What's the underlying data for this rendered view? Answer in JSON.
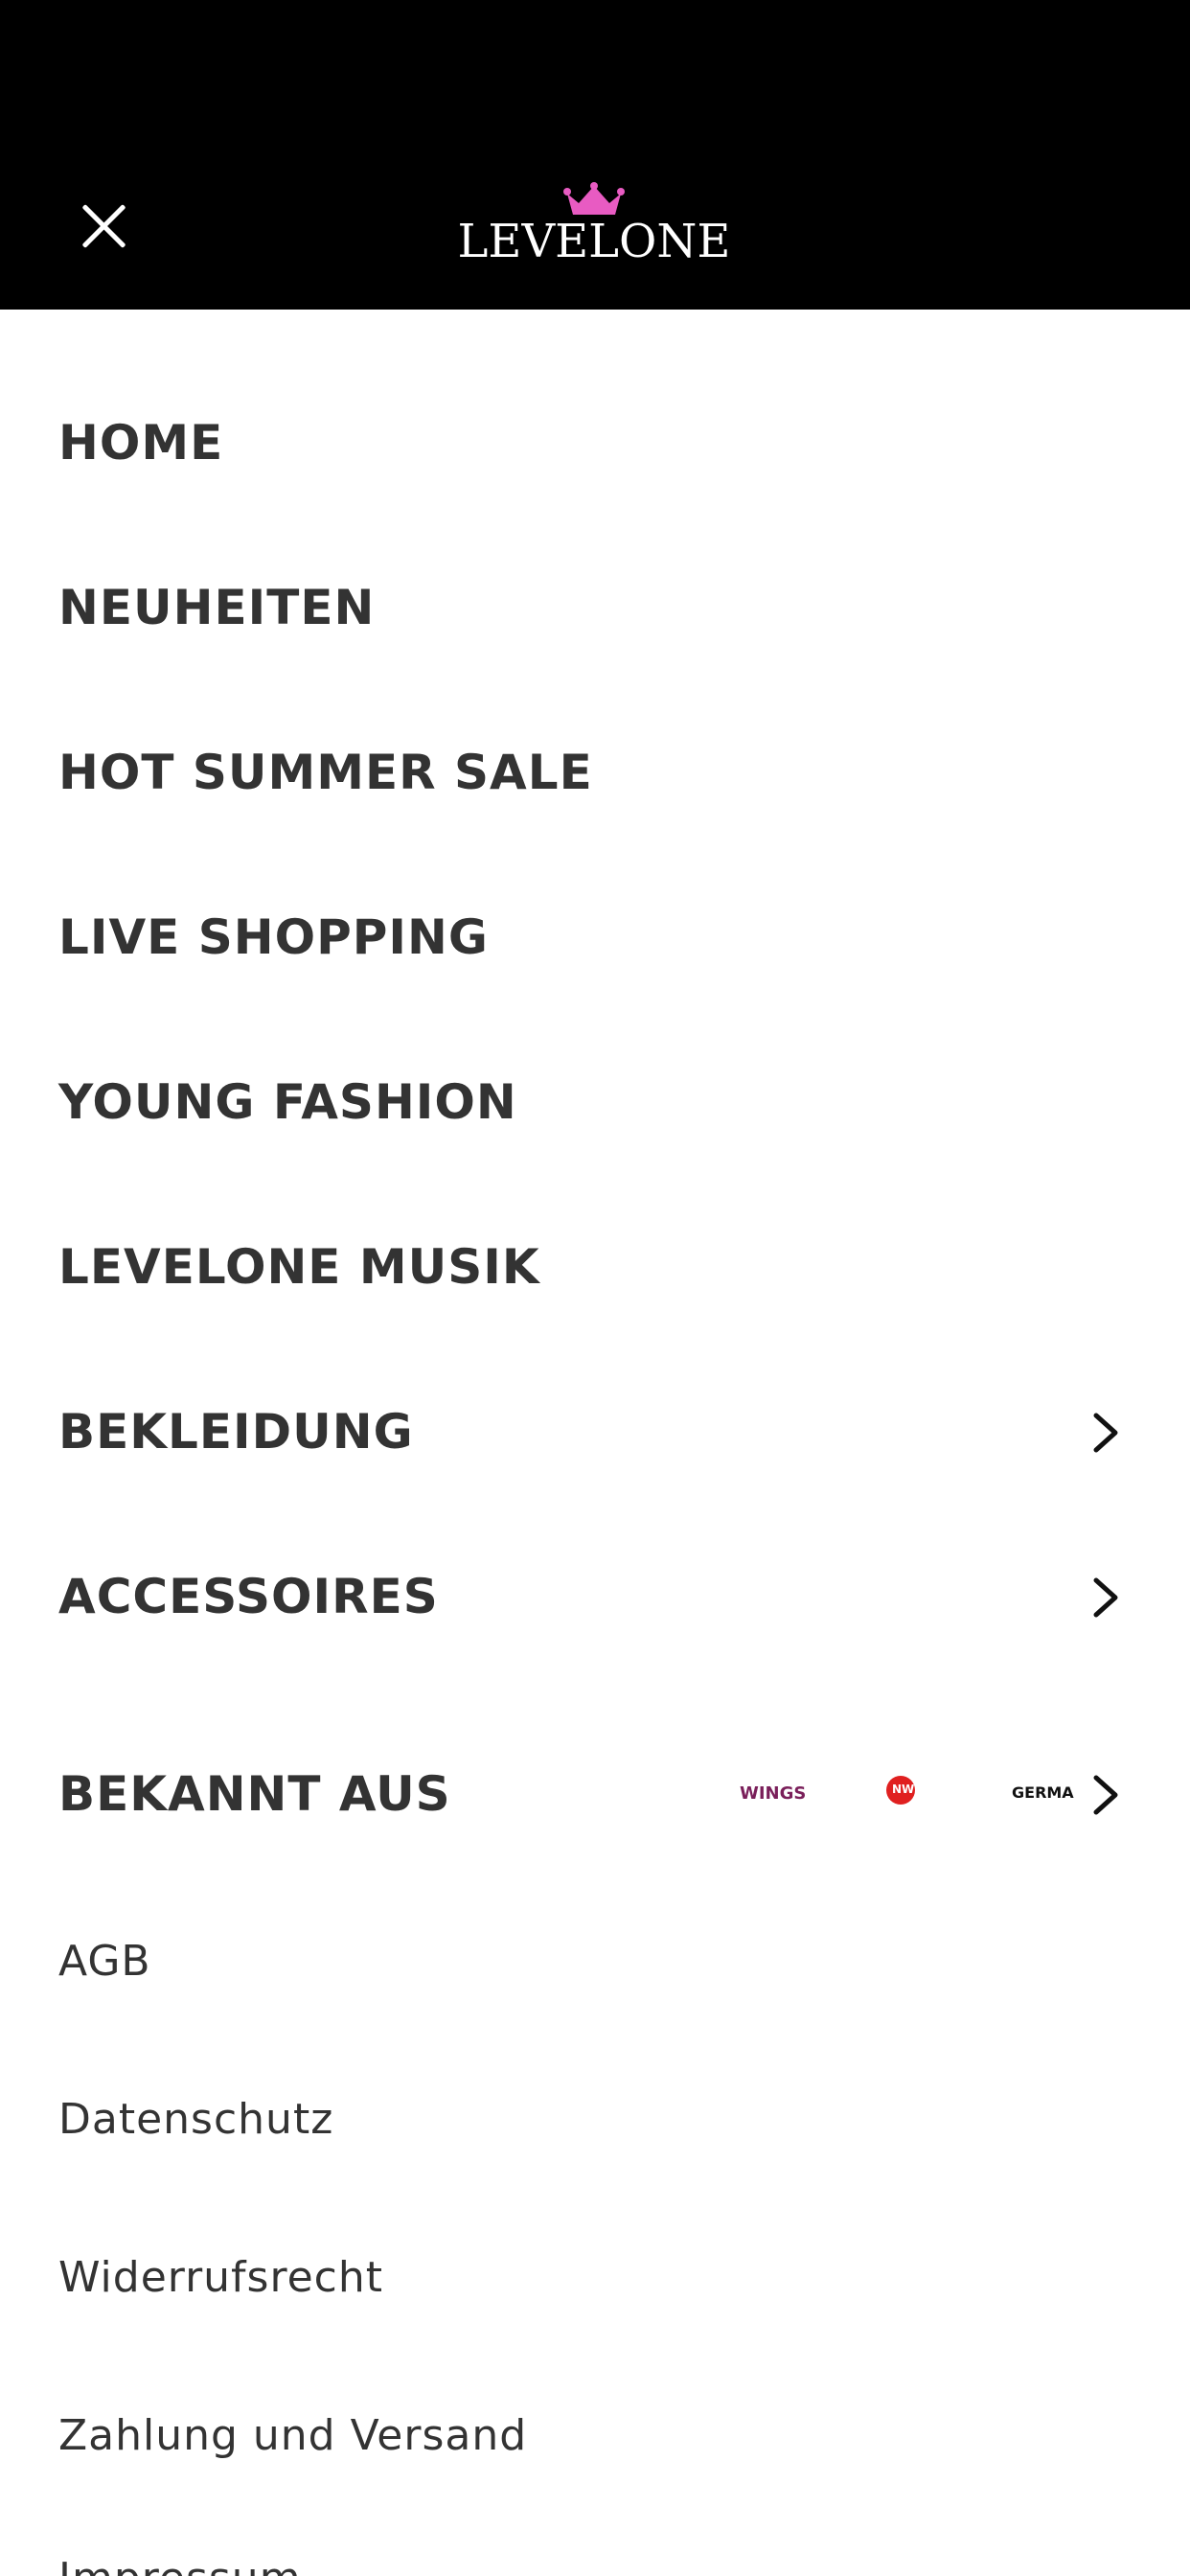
{
  "header": {
    "logo_text": "LEVELONE",
    "brand_color": "#e85bc2",
    "close_icon": "close-icon"
  },
  "menu": {
    "items": [
      {
        "label": "HOME",
        "has_chevron": false
      },
      {
        "label": "NEUHEITEN",
        "has_chevron": false
      },
      {
        "label": "HOT SUMMER SALE",
        "has_chevron": false
      },
      {
        "label": "LIVE SHOPPING",
        "has_chevron": false
      },
      {
        "label": "YOUNG FASHION",
        "has_chevron": false
      },
      {
        "label": "LEVELONE MUSIK",
        "has_chevron": false
      },
      {
        "label": "BEKLEIDUNG",
        "has_chevron": true
      },
      {
        "label": "ACCESSOIRES",
        "has_chevron": true
      },
      {
        "label": "BEKANNT AUS",
        "has_chevron": true
      }
    ],
    "bekannt_aus_logos": [
      "WINGS",
      "NW",
      "GERMA"
    ],
    "legal": [
      {
        "label": "AGB"
      },
      {
        "label": "Datenschutz"
      },
      {
        "label": "Widerrufsrecht"
      },
      {
        "label": "Zahlung und Versand"
      },
      {
        "label": "Impressum"
      }
    ]
  }
}
